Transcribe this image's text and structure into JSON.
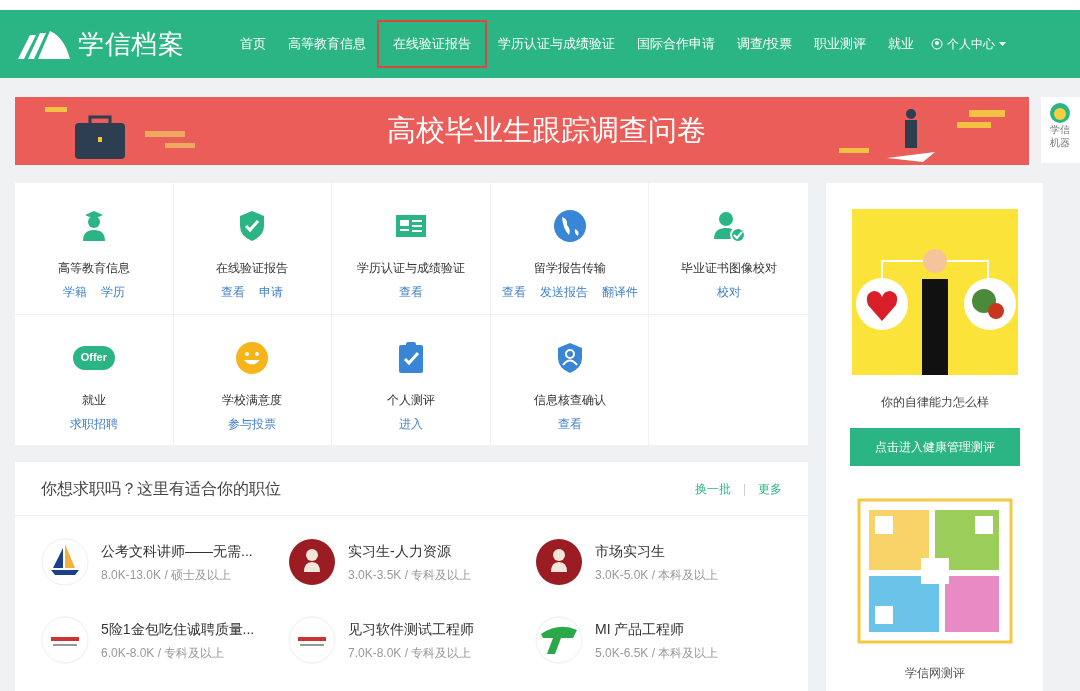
{
  "header": {
    "logo_text": "学信档案",
    "nav": [
      {
        "label": "首页",
        "highlighted": false
      },
      {
        "label": "高等教育信息",
        "highlighted": false
      },
      {
        "label": "在线验证报告",
        "highlighted": true
      },
      {
        "label": "学历认证与成绩验证",
        "highlighted": false
      },
      {
        "label": "国际合作申请",
        "highlighted": false
      },
      {
        "label": "调查/投票",
        "highlighted": false
      },
      {
        "label": "职业测评",
        "highlighted": false
      },
      {
        "label": "就业",
        "highlighted": false
      }
    ],
    "user_menu": "个人中心"
  },
  "banner": {
    "title": "高校毕业生跟踪调查问卷"
  },
  "side_widget": {
    "lines": [
      "学信",
      "机器"
    ]
  },
  "services": [
    {
      "kind": "graduate",
      "title": "高等教育信息",
      "links": [
        "学籍",
        "学历"
      ]
    },
    {
      "kind": "shield",
      "title": "在线验证报告",
      "links": [
        "查看",
        "申请"
      ]
    },
    {
      "kind": "card",
      "title": "学历认证与成绩验证",
      "links": [
        "查看"
      ]
    },
    {
      "kind": "globe",
      "title": "留学报告传输",
      "links": [
        "查看",
        "发送报告",
        "翻译件"
      ]
    },
    {
      "kind": "usercheck",
      "title": "毕业证书图像校对",
      "links": [
        "校对"
      ]
    },
    {
      "kind": "offer",
      "icon_text": "Offer",
      "title": "就业",
      "links": [
        "求职招聘"
      ]
    },
    {
      "kind": "smile",
      "title": "学校满意度",
      "links": [
        "参与投票"
      ]
    },
    {
      "kind": "clipboard",
      "title": "个人测评",
      "links": [
        "进入"
      ]
    },
    {
      "kind": "usershield",
      "title": "信息核查确认",
      "links": [
        "查看"
      ]
    }
  ],
  "jobs": {
    "title": "你想求职吗？这里有适合你的职位",
    "actions": [
      "换一批",
      "更多"
    ],
    "action_separator": "|",
    "items": [
      {
        "title": "公考文科讲师——无需...",
        "meta": "8.0K-13.0K / 硕士及以上",
        "kind": "boat"
      },
      {
        "title": "实习生-人力资源",
        "meta": "3.0K-3.5K / 专科及以上",
        "kind": "figure"
      },
      {
        "title": "市场实习生",
        "meta": "3.0K-5.0K / 本科及以上",
        "kind": "figure"
      },
      {
        "title": "5险1金包吃住诚聘质量...",
        "meta": "6.0K-8.0K / 专科及以上",
        "kind": "plain"
      },
      {
        "title": "见习软件测试工程师",
        "meta": "7.0K-8.0K / 专科及以上",
        "kind": "plain"
      },
      {
        "title": "MI 产品工程师",
        "meta": "5.0K-6.5K / 本科及以上",
        "kind": "stripe"
      }
    ]
  },
  "promo": {
    "caption": "你的自律能力怎么样",
    "button": "点击进入健康管理测评",
    "qr_caption": "学信网测评"
  }
}
